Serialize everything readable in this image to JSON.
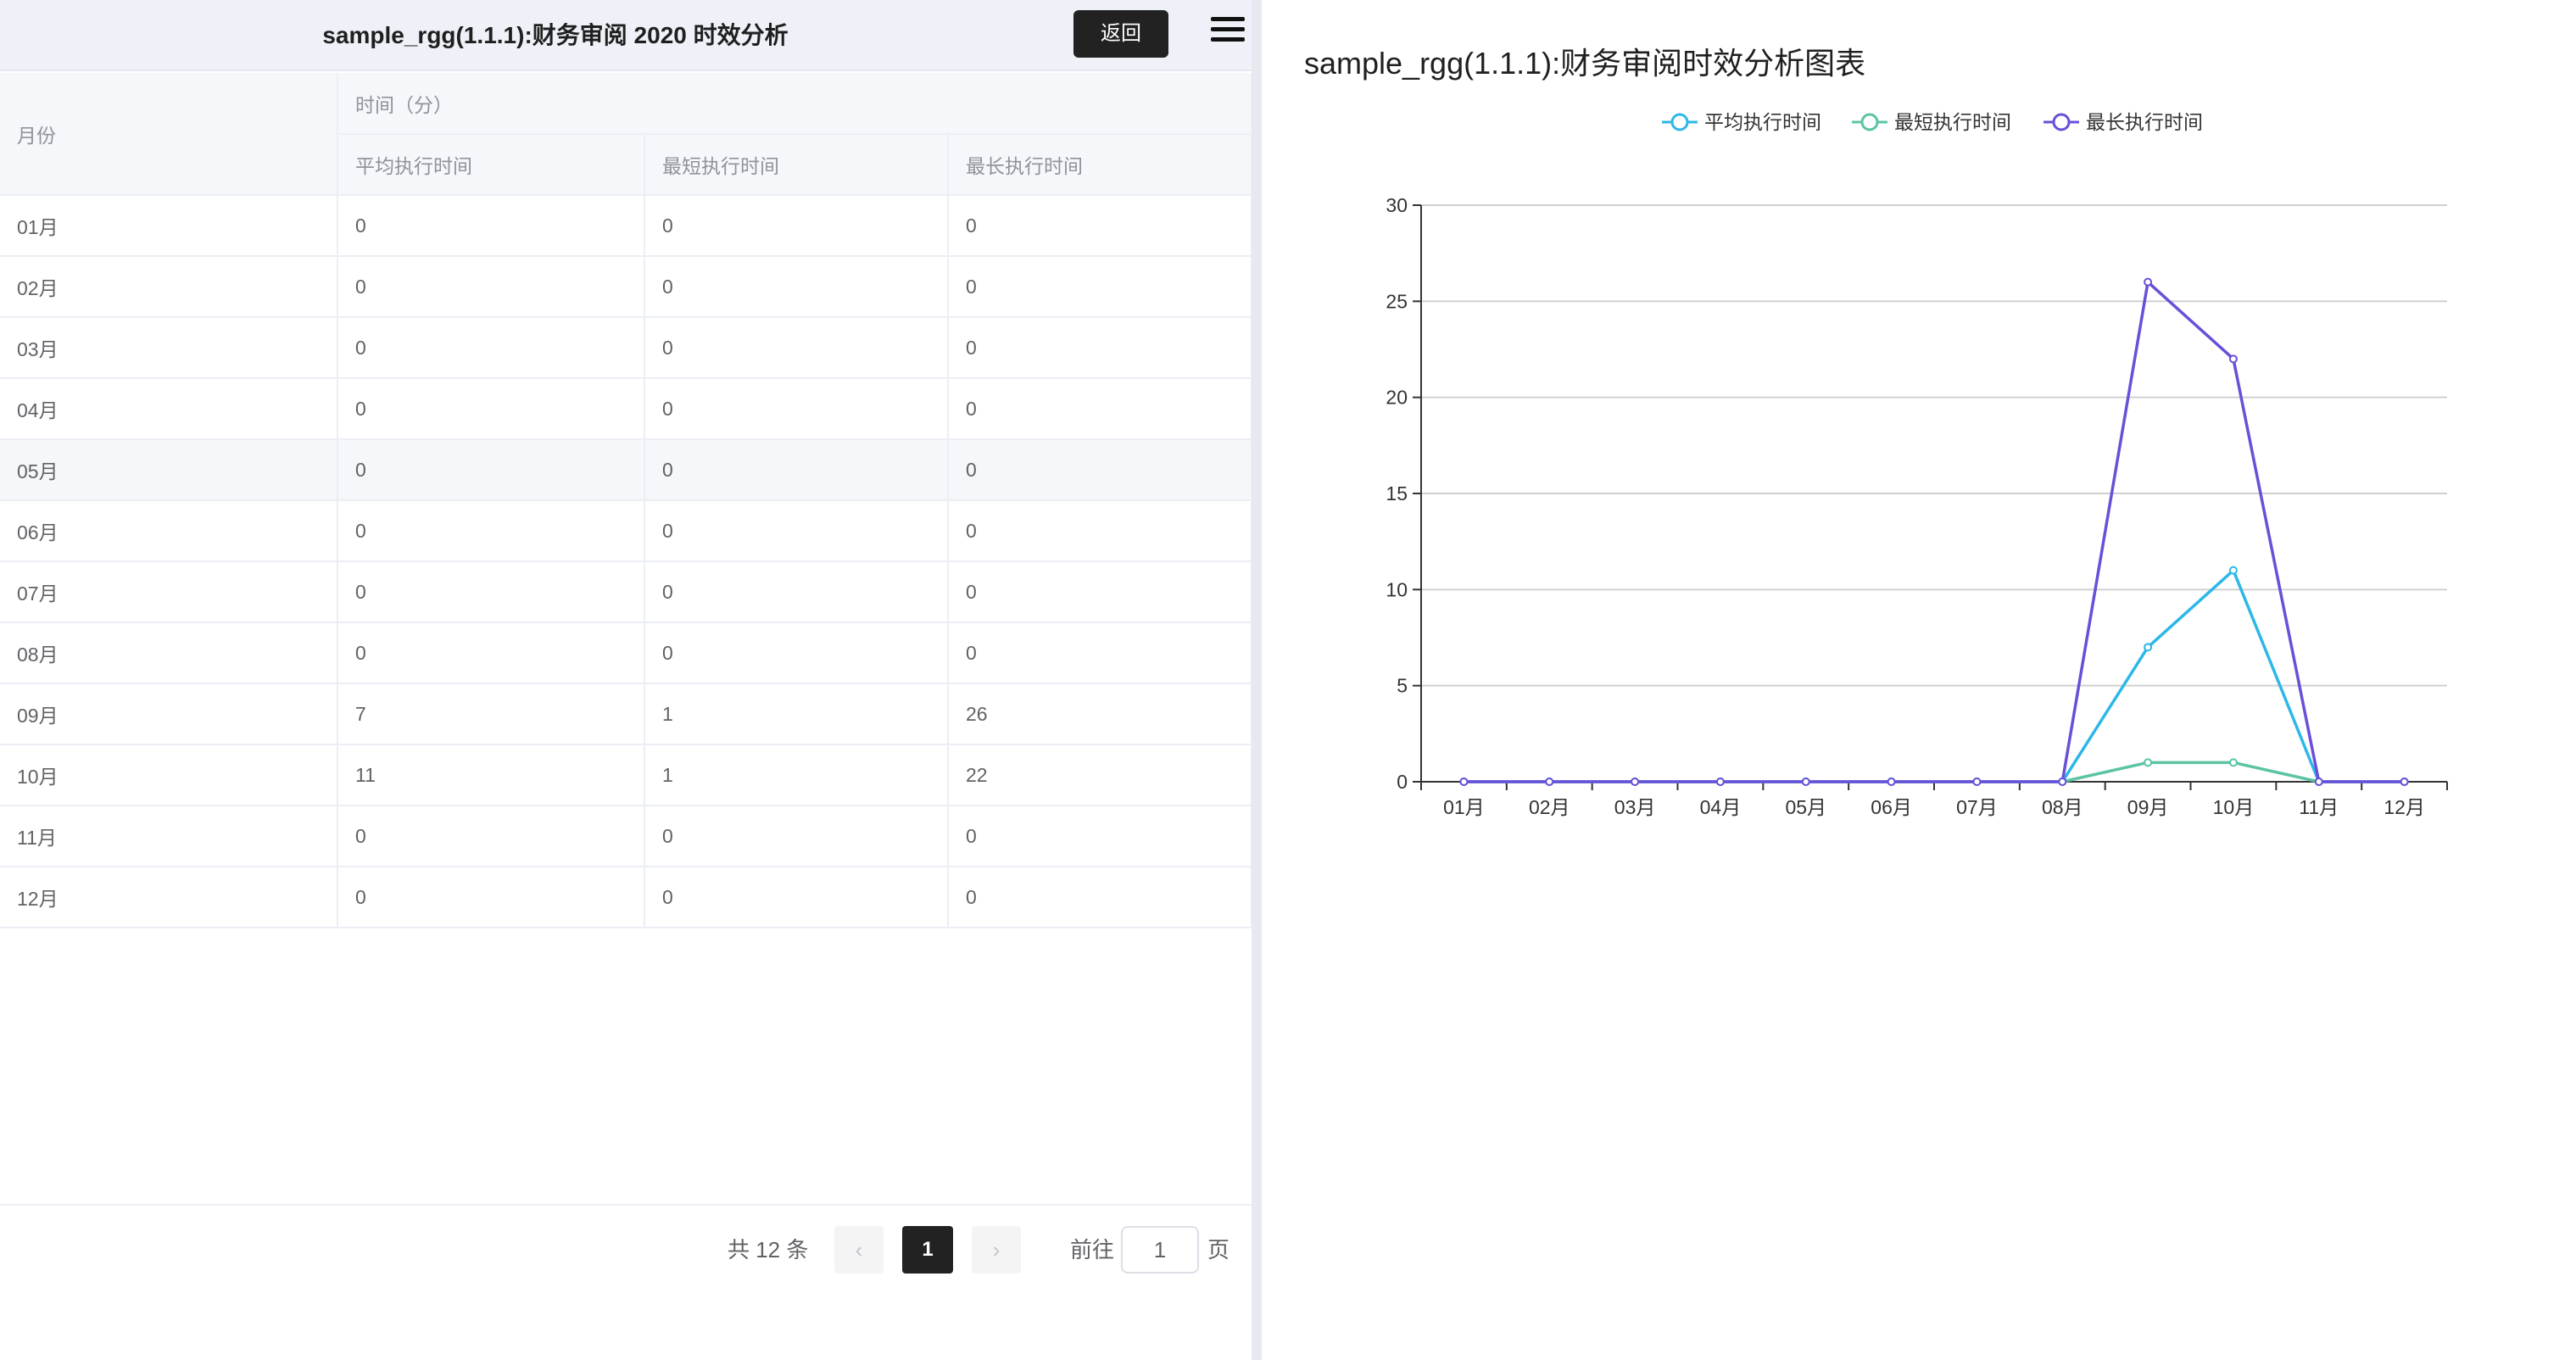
{
  "left": {
    "title": "sample_rgg(1.1.1):财务审阅 2020 时效分析",
    "back_label": "返回",
    "table": {
      "month_header": "月份",
      "group_header": "时间（分）",
      "columns": [
        "平均执行时间",
        "最短执行时间",
        "最长执行时间"
      ],
      "rows": [
        {
          "month": "01月",
          "avg": "0",
          "min": "0",
          "max": "0"
        },
        {
          "month": "02月",
          "avg": "0",
          "min": "0",
          "max": "0"
        },
        {
          "month": "03月",
          "avg": "0",
          "min": "0",
          "max": "0"
        },
        {
          "month": "04月",
          "avg": "0",
          "min": "0",
          "max": "0"
        },
        {
          "month": "05月",
          "avg": "0",
          "min": "0",
          "max": "0"
        },
        {
          "month": "06月",
          "avg": "0",
          "min": "0",
          "max": "0"
        },
        {
          "month": "07月",
          "avg": "0",
          "min": "0",
          "max": "0"
        },
        {
          "month": "08月",
          "avg": "0",
          "min": "0",
          "max": "0"
        },
        {
          "month": "09月",
          "avg": "7",
          "min": "1",
          "max": "26"
        },
        {
          "month": "10月",
          "avg": "11",
          "min": "1",
          "max": "22"
        },
        {
          "month": "11月",
          "avg": "0",
          "min": "0",
          "max": "0"
        },
        {
          "month": "12月",
          "avg": "0",
          "min": "0",
          "max": "0"
        }
      ]
    },
    "pagination": {
      "total": "共 12 条",
      "prev_icon": "‹",
      "current_page": "1",
      "next_icon": "›",
      "goto_label": "前往",
      "goto_value": "1",
      "page_label": "页"
    }
  },
  "chart_data": {
    "type": "line",
    "title": "sample_rgg(1.1.1):财务审阅时效分析图表",
    "categories": [
      "01月",
      "02月",
      "03月",
      "04月",
      "05月",
      "06月",
      "07月",
      "08月",
      "09月",
      "10月",
      "11月",
      "12月"
    ],
    "series": [
      {
        "name": "平均执行时间",
        "color": "#2db7e8",
        "values": [
          0,
          0,
          0,
          0,
          0,
          0,
          0,
          0,
          7,
          11,
          0,
          0
        ]
      },
      {
        "name": "最短执行时间",
        "color": "#5cc3a4",
        "values": [
          0,
          0,
          0,
          0,
          0,
          0,
          0,
          0,
          1,
          1,
          0,
          0
        ]
      },
      {
        "name": "最长执行时间",
        "color": "#6a4fd8",
        "values": [
          0,
          0,
          0,
          0,
          0,
          0,
          0,
          0,
          26,
          22,
          0,
          0
        ]
      }
    ],
    "ylim": [
      0,
      30
    ],
    "yticks": [
      0,
      5,
      10,
      15,
      20,
      25,
      30
    ],
    "grid": true,
    "legend_position": "top-center"
  }
}
